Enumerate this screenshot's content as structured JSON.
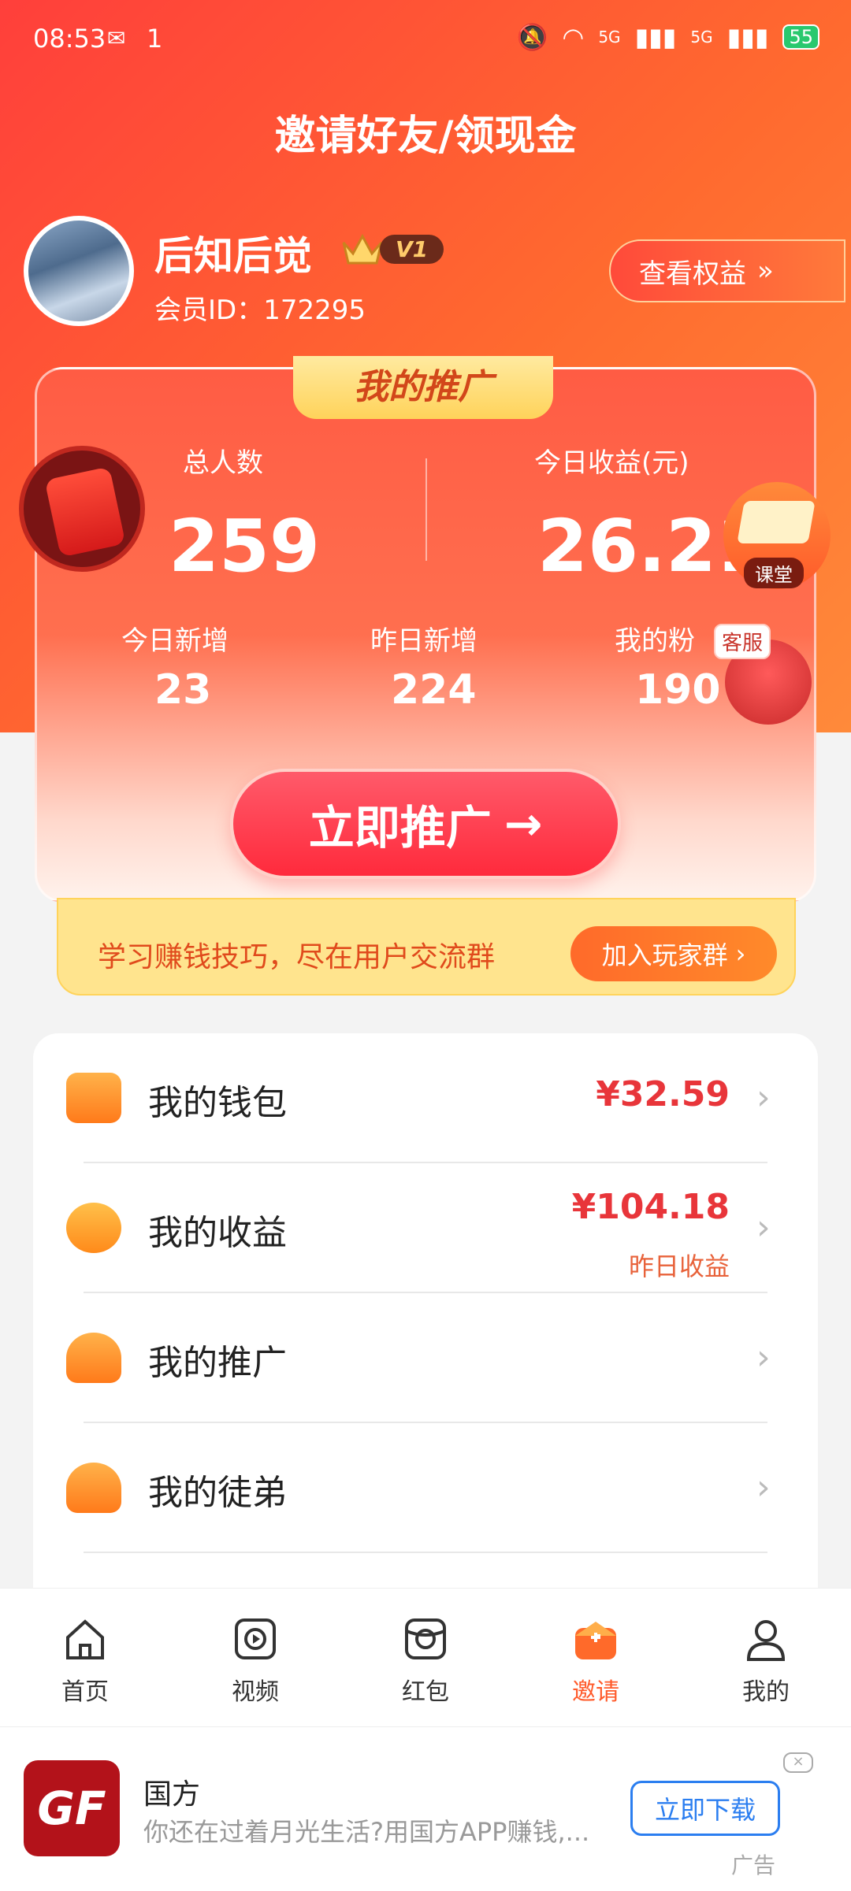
{
  "status_bar": {
    "time": "08:53",
    "notif_count": "1",
    "battery": "55",
    "signal1": "5G",
    "signal2": "5G"
  },
  "header": {
    "title": "邀请好友/领现金"
  },
  "user": {
    "name": "后知后觉",
    "level": "V1",
    "member_id": "会员ID：172295",
    "rights_button": "查看权益"
  },
  "promo_card": {
    "tab_title": "我的推广",
    "total_label": "总人数",
    "total_value": "259",
    "income_label": "今日收益(元)",
    "income_value": "26.21",
    "today_new_label": "今日新增",
    "today_new_value": "23",
    "yesterday_new_label": "昨日新增",
    "yesterday_new_value": "224",
    "fans_label": "我的粉",
    "fans_value": "190",
    "promote_button": "立即推广",
    "school_label": "课堂",
    "service_label": "客服"
  },
  "tip": {
    "text": "学习赚钱技巧，尽在用户交流群",
    "button": "加入玩家群"
  },
  "menu": [
    {
      "label": "我的钱包",
      "value": "¥32.59",
      "sub": ""
    },
    {
      "label": "我的收益",
      "value": "¥104.18",
      "sub": "昨日收益"
    },
    {
      "label": "我的推广",
      "value": "",
      "sub": ""
    },
    {
      "label": "我的徒弟",
      "value": "",
      "sub": ""
    }
  ],
  "tabs": [
    {
      "label": "首页",
      "icon": "home-icon"
    },
    {
      "label": "视频",
      "icon": "video-icon"
    },
    {
      "label": "红包",
      "icon": "redpacket-icon"
    },
    {
      "label": "邀请",
      "icon": "invite-icon"
    },
    {
      "label": "我的",
      "icon": "profile-icon"
    }
  ],
  "ad": {
    "logo": "GF",
    "title": "国方",
    "desc": "你还在过着月光生活?用国方APP赚钱,...",
    "button": "立即下载",
    "tag": "广告",
    "close": "×"
  },
  "colors": {
    "accent": "#ff5a2a",
    "price": "#e8353a",
    "link_blue": "#2b7ef0"
  }
}
